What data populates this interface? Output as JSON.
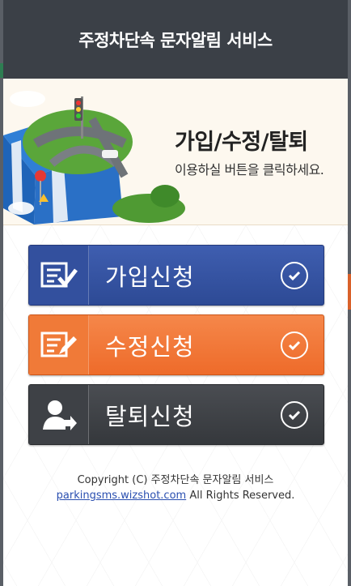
{
  "header": {
    "title": "주정차단속 문자알림 서비스"
  },
  "banner": {
    "title": "가입/수정/탈퇴",
    "subtitle": "이용하실 버튼을 클릭하세요."
  },
  "buttons": [
    {
      "label": "가입신청",
      "icon": "document-check-icon",
      "color": "#2d4a95"
    },
    {
      "label": "수정신청",
      "icon": "document-edit-icon",
      "color": "#ee6b2a"
    },
    {
      "label": "탈퇴신청",
      "icon": "user-leave-icon",
      "color": "#35383c"
    }
  ],
  "footer": {
    "copyright": "Copyright (C) 주정차단속 문자알림 서비스",
    "link": "parkingsms.wizshot.com",
    "rights": " All Rights Reserved."
  }
}
